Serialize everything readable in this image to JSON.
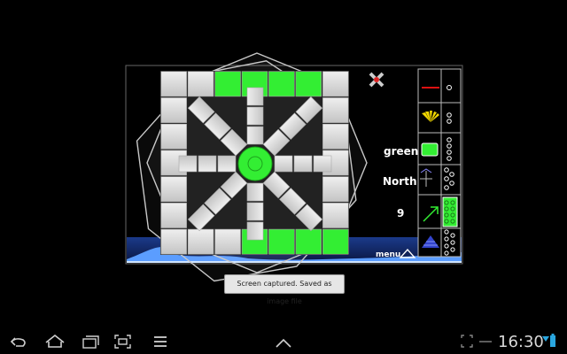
{
  "game": {
    "color_label": "green",
    "direction_label": "North",
    "count_label": "9",
    "menu_label": "menu",
    "colors": {
      "green": "#33ee33",
      "tile": "#d6d6d6",
      "red": "#dd1111",
      "yellow": "#f2d800",
      "blue": "#2255ff"
    }
  },
  "toast": {
    "message": "Screen captured. Saved as image file"
  },
  "system_bar": {
    "clock": "16:30",
    "icons": [
      "back-icon",
      "home-icon",
      "recent-apps-icon",
      "screenshot-icon",
      "menu-icon",
      "up-chevron-icon",
      "fullscreen-icon",
      "usb-icon",
      "battery-icon"
    ]
  }
}
